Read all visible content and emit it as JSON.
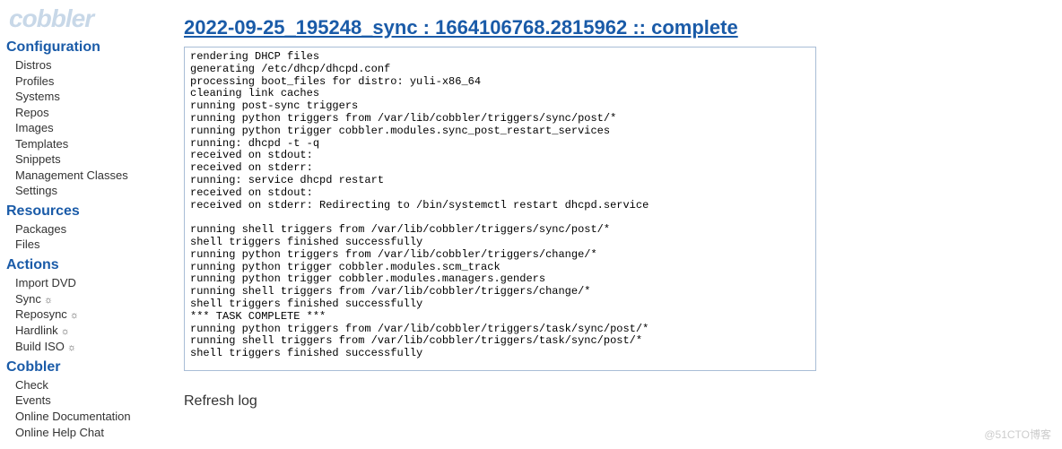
{
  "logo": "cobbler",
  "sidebar": {
    "sections": [
      {
        "header": "Configuration",
        "items": [
          {
            "label": "Distros",
            "gear": false
          },
          {
            "label": "Profiles",
            "gear": false
          },
          {
            "label": "Systems",
            "gear": false
          },
          {
            "label": "Repos",
            "gear": false
          },
          {
            "label": "Images",
            "gear": false
          },
          {
            "label": "Templates",
            "gear": false
          },
          {
            "label": "Snippets",
            "gear": false
          },
          {
            "label": "Management Classes",
            "gear": false
          },
          {
            "label": "Settings",
            "gear": false
          }
        ]
      },
      {
        "header": "Resources",
        "items": [
          {
            "label": "Packages",
            "gear": false
          },
          {
            "label": "Files",
            "gear": false
          }
        ]
      },
      {
        "header": "Actions",
        "items": [
          {
            "label": "Import DVD",
            "gear": false
          },
          {
            "label": "Sync",
            "gear": true
          },
          {
            "label": "Reposync",
            "gear": true
          },
          {
            "label": "Hardlink",
            "gear": true
          },
          {
            "label": "Build ISO",
            "gear": true
          }
        ]
      },
      {
        "header": "Cobbler",
        "items": [
          {
            "label": "Check",
            "gear": false
          },
          {
            "label": "Events",
            "gear": false
          },
          {
            "label": "Online Documentation",
            "gear": false
          },
          {
            "label": "Online Help Chat",
            "gear": false
          }
        ]
      }
    ]
  },
  "main": {
    "title": "2022-09-25_195248_sync : 1664106768.2815962 :: complete",
    "log_content": "rendering DHCP files\ngenerating /etc/dhcp/dhcpd.conf\nprocessing boot_files for distro: yuli-x86_64\ncleaning link caches\nrunning post-sync triggers\nrunning python triggers from /var/lib/cobbler/triggers/sync/post/*\nrunning python trigger cobbler.modules.sync_post_restart_services\nrunning: dhcpd -t -q\nreceived on stdout: \nreceived on stderr: \nrunning: service dhcpd restart\nreceived on stdout: \nreceived on stderr: Redirecting to /bin/systemctl restart dhcpd.service\n\nrunning shell triggers from /var/lib/cobbler/triggers/sync/post/*\nshell triggers finished successfully\nrunning python triggers from /var/lib/cobbler/triggers/change/*\nrunning python trigger cobbler.modules.scm_track\nrunning python trigger cobbler.modules.managers.genders\nrunning shell triggers from /var/lib/cobbler/triggers/change/*\nshell triggers finished successfully\n*** TASK COMPLETE ***\nrunning python triggers from /var/lib/cobbler/triggers/task/sync/post/*\nrunning shell triggers from /var/lib/cobbler/triggers/task/sync/post/*\nshell triggers finished successfully",
    "refresh_label": "Refresh log"
  },
  "watermark": "@51CTO博客",
  "gear_glyph": "☼"
}
